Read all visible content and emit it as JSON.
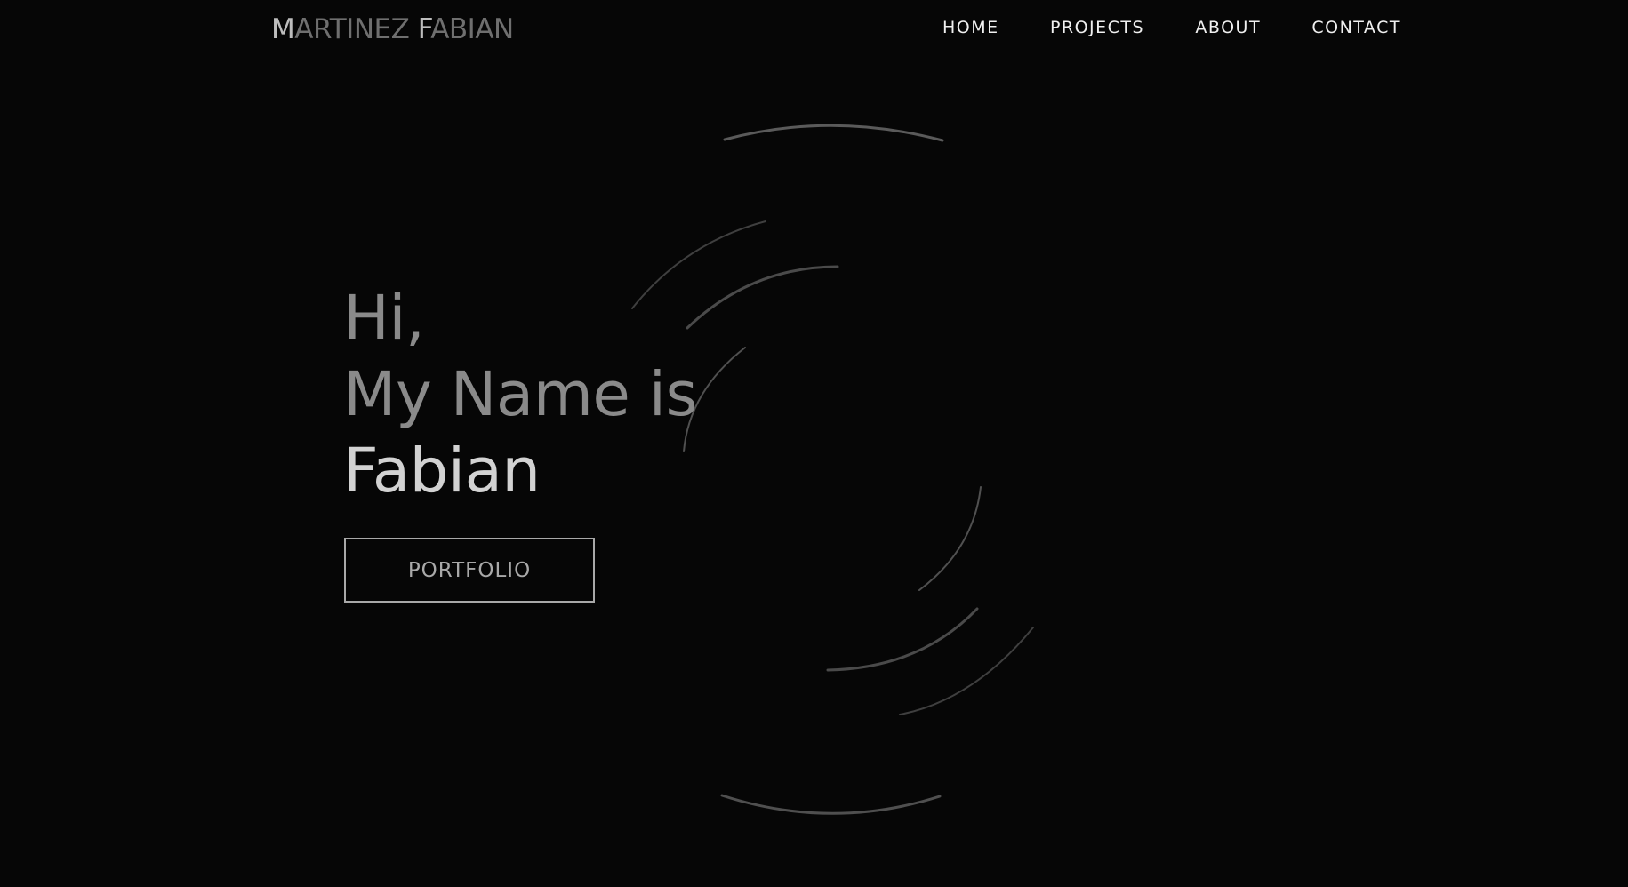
{
  "header": {
    "logo": {
      "first_initial": "M",
      "first_rest": "ARTINEZ",
      "last_initial": "F",
      "last_rest": "ABIAN"
    },
    "nav": [
      {
        "label": "HOME"
      },
      {
        "label": "PROJECTS"
      },
      {
        "label": "ABOUT"
      },
      {
        "label": "CONTACT"
      }
    ]
  },
  "hero": {
    "line1": "Hi,",
    "line2": "My Name is",
    "line3": "Fabian",
    "button_label": "PORTFOLIO"
  },
  "colors": {
    "background": "#060606",
    "nav_text": "#f0f0f0",
    "muted_text": "#8a8a8a",
    "bright_text": "#d2d2d2",
    "ring_stroke": "#4a4a4a"
  }
}
